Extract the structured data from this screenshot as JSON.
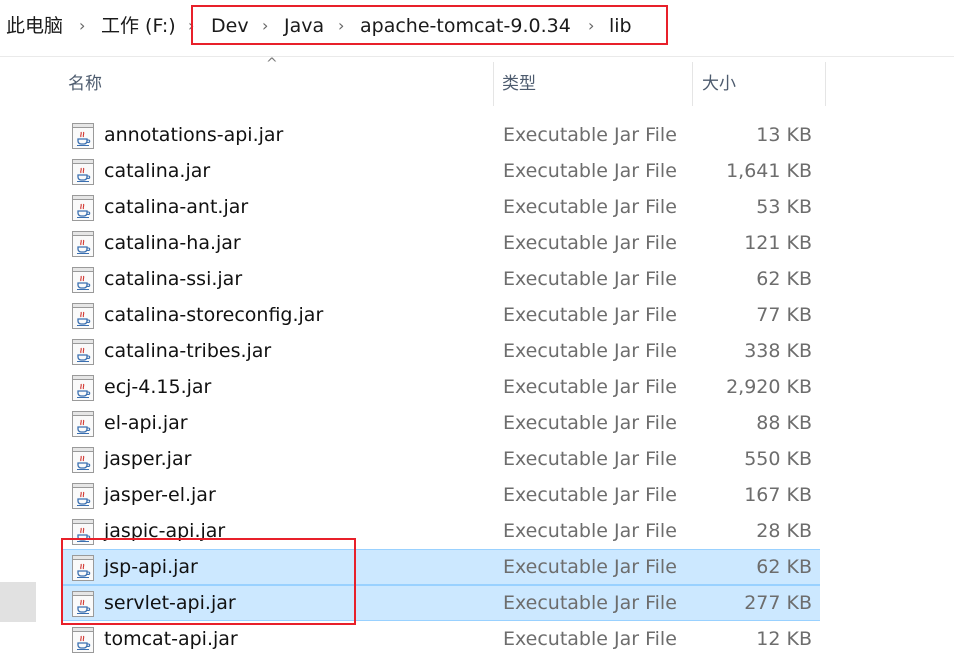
{
  "breadcrumb": {
    "items": [
      "此电脑",
      "工作 (F:)",
      "Dev",
      "Java",
      "apache-tomcat-9.0.34",
      "lib"
    ]
  },
  "columns": {
    "name": "名称",
    "type": "类型",
    "size": "大小"
  },
  "colors": {
    "highlight_box": "#e8202a",
    "selection": "#cce8ff"
  },
  "files": [
    {
      "name": "annotations-api.jar",
      "type": "Executable Jar File",
      "size": "13 KB",
      "icon": "jar-file-icon"
    },
    {
      "name": "catalina.jar",
      "type": "Executable Jar File",
      "size": "1,641 KB",
      "icon": "jar-file-icon"
    },
    {
      "name": "catalina-ant.jar",
      "type": "Executable Jar File",
      "size": "53 KB",
      "icon": "jar-file-icon"
    },
    {
      "name": "catalina-ha.jar",
      "type": "Executable Jar File",
      "size": "121 KB",
      "icon": "jar-file-icon"
    },
    {
      "name": "catalina-ssi.jar",
      "type": "Executable Jar File",
      "size": "62 KB",
      "icon": "jar-file-icon"
    },
    {
      "name": "catalina-storeconfig.jar",
      "type": "Executable Jar File",
      "size": "77 KB",
      "icon": "jar-file-icon"
    },
    {
      "name": "catalina-tribes.jar",
      "type": "Executable Jar File",
      "size": "338 KB",
      "icon": "jar-file-icon"
    },
    {
      "name": "ecj-4.15.jar",
      "type": "Executable Jar File",
      "size": "2,920 KB",
      "icon": "jar-file-icon"
    },
    {
      "name": "el-api.jar",
      "type": "Executable Jar File",
      "size": "88 KB",
      "icon": "jar-file-icon"
    },
    {
      "name": "jasper.jar",
      "type": "Executable Jar File",
      "size": "550 KB",
      "icon": "jar-file-icon"
    },
    {
      "name": "jasper-el.jar",
      "type": "Executable Jar File",
      "size": "167 KB",
      "icon": "jar-file-icon"
    },
    {
      "name": "jaspic-api.jar",
      "type": "Executable Jar File",
      "size": "28 KB",
      "icon": "jar-file-icon"
    },
    {
      "name": "jsp-api.jar",
      "type": "Executable Jar File",
      "size": "62 KB",
      "icon": "jar-file-icon",
      "selected": true
    },
    {
      "name": "servlet-api.jar",
      "type": "Executable Jar File",
      "size": "277 KB",
      "icon": "jar-file-icon",
      "selected": true
    },
    {
      "name": "tomcat-api.jar",
      "type": "Executable Jar File",
      "size": "12 KB",
      "icon": "jar-file-icon"
    }
  ]
}
